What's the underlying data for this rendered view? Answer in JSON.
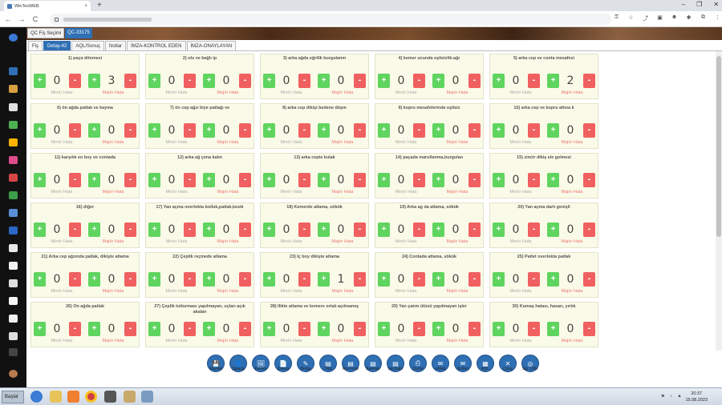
{
  "browser": {
    "tab_title": "WinTexWEB",
    "tab_close": "×",
    "new_tab": "+",
    "window_controls": [
      "–",
      "❐",
      "✕"
    ],
    "nav": [
      "←",
      "→",
      "C"
    ],
    "omnibox_icons": [
      "⚿",
      "☆",
      "⤴",
      "▣",
      "☻",
      "✱",
      "⧉",
      "⋮"
    ]
  },
  "app": {
    "tab_qc_selection": "QC Fiş Seçimi",
    "tab_qc_code": "QC-33175",
    "subtabs": [
      "Fiş",
      "Detay-42",
      "AQL/Sonuç",
      "Notlar",
      "İMZA-KONTROL EDEN",
      "İMZA-ONAYLAYAN"
    ],
    "active_subtab": "Detay-42"
  },
  "labels": {
    "plus": "+",
    "minus": "-",
    "minor": "Minör Hata",
    "major": "Majör Hata"
  },
  "defects": [
    {
      "title": "1) paça dönmesi",
      "minor": "0",
      "major": "3"
    },
    {
      "title": "2) olu ve bağlı ip",
      "minor": "0",
      "major": "0"
    },
    {
      "title": "3) arka ağda eğrilik burgulanm",
      "minor": "0",
      "major": "0"
    },
    {
      "title": "4) kemer ucunda eşitsizlik.ağr",
      "minor": "0",
      "major": "0"
    },
    {
      "title": "5) arka cep ve conta mesafesi",
      "minor": "0",
      "major": "2"
    },
    {
      "title": "6) ön ağda patlak ve kayma",
      "minor": "0",
      "major": "0"
    },
    {
      "title": "7) ön cep ağzı biye patlağı ve",
      "minor": "0",
      "major": "0"
    },
    {
      "title": "8) arka cep dikişi bedene düşm",
      "minor": "0",
      "major": "0"
    },
    {
      "title": "9) kopru mesafelerinde eşitsiz",
      "minor": "0",
      "major": "0"
    },
    {
      "title": "10) arka cep ve kopru altına k",
      "minor": "0",
      "major": "0"
    },
    {
      "title": "11) karşılık en boy ve contada",
      "minor": "0",
      "major": "0"
    },
    {
      "title": "12) arka ağ çıma kalın",
      "minor": "0",
      "major": "0"
    },
    {
      "title": "13) arka cepte kulak",
      "minor": "0",
      "major": "0"
    },
    {
      "title": "14) paçada marullanma,burgulan",
      "minor": "0",
      "major": "0"
    },
    {
      "title": "15) zincir dikiş ele gelmesi",
      "minor": "0",
      "major": "0"
    },
    {
      "title": "16) diğer",
      "minor": "0",
      "major": "0"
    },
    {
      "title": "17) Yan açma overlokta bolluk,patlak,kesik",
      "minor": "0",
      "major": "0"
    },
    {
      "title": "18) Kemerde atlama, sökük",
      "minor": "0",
      "major": "0"
    },
    {
      "title": "19) Arka ag da atlama, sökük",
      "minor": "0",
      "major": "0"
    },
    {
      "title": "20) Yan açma darlı genişli",
      "minor": "0",
      "major": "0"
    },
    {
      "title": "21) Arka cep ağzında patlak, dikişte atlama",
      "minor": "0",
      "major": "0"
    },
    {
      "title": "22) Çeplik reçmede atlama",
      "minor": "0",
      "major": "0"
    },
    {
      "title": "23) İç boy dikişte atlama",
      "minor": "0",
      "major": "1"
    },
    {
      "title": "24) Contada atlama, sökük",
      "minor": "0",
      "major": "0"
    },
    {
      "title": "25) Patlet overlokta patlak",
      "minor": "0",
      "major": "0"
    },
    {
      "title": "26) Ön ağda patlak",
      "minor": "0",
      "major": "0"
    },
    {
      "title": "27) Çeplik tutturması yapılmayan, uçları açık akalan",
      "minor": "0",
      "major": "0"
    },
    {
      "title": "28) İlikte atlama ve kemere ortalı açılmamış",
      "minor": "0",
      "major": "0"
    },
    {
      "title": "29) Yan çatım ütüsü yapılmayan işler",
      "minor": "0",
      "major": "0"
    },
    {
      "title": "30) Kumaş hatası, hasarı, yırtık",
      "minor": "0",
      "major": "0"
    }
  ],
  "toolbar": [
    {
      "label": "Kaydet",
      "icon": "💾"
    },
    {
      "label": "Sipariş",
      "icon": "👤"
    },
    {
      "label": "Resim",
      "icon": "🖼"
    },
    {
      "label": "Dosya",
      "icon": "📄"
    },
    {
      "label": "Belge",
      "icon": "✎"
    },
    {
      "label": "Ölçü",
      "icon": "▤"
    },
    {
      "label": "Ara Final",
      "icon": "▤"
    },
    {
      "label": "Satırları",
      "icon": "▤"
    },
    {
      "label": "SeçSatır",
      "icon": "▤"
    },
    {
      "label": "Yazdır",
      "icon": "⎙"
    },
    {
      "label": "eMail",
      "icon": "✉"
    },
    {
      "label": "Notları",
      "icon": "✉"
    },
    {
      "label": "AQL",
      "icon": "▦"
    },
    {
      "label": "Çıkış",
      "icon": "✕"
    },
    {
      "label": "Sip. Dök.",
      "icon": "◎"
    }
  ],
  "taskbar": {
    "start": "Başlat",
    "time": "20:37",
    "date": "15.08.2023",
    "tray": [
      "⚑",
      "♪",
      "▲"
    ]
  },
  "colors": {
    "plus": "#5fd45f",
    "minus": "#f06060",
    "card_bg": "#fafae8",
    "accent": "#2f6fb4"
  }
}
